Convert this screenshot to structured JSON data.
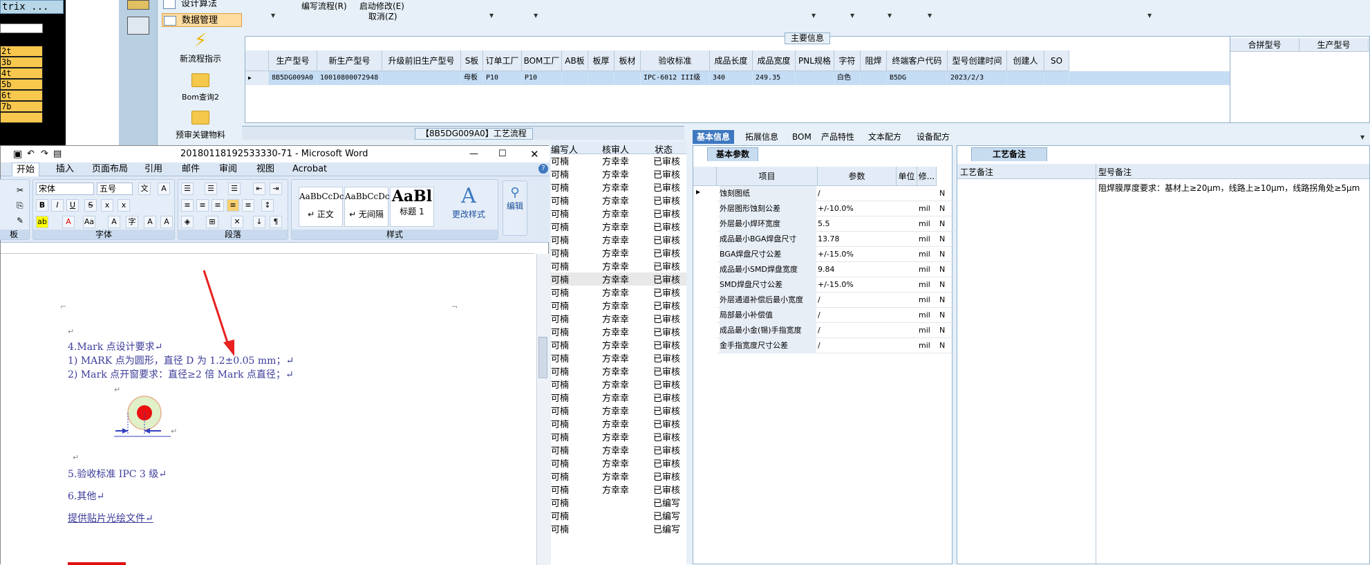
{
  "left_strip": {
    "title": "trix ...",
    "items": [
      "2t",
      "3b",
      "4t",
      "5b",
      "6t",
      "7b",
      ""
    ]
  },
  "nav": {
    "items": [
      {
        "label": "设计算法",
        "selected": false
      },
      {
        "label": "数据管理",
        "selected": true
      }
    ],
    "tools": [
      "新流程指示",
      "Bom查询2",
      "预审关键物料"
    ]
  },
  "menu": {
    "items": [
      "编写流程(R)",
      "启动修改(E)",
      "取消(Z)"
    ]
  },
  "main_info": {
    "title": "主要信息",
    "columns": [
      "生产型号",
      "新生产型号",
      "升级前旧生产型号",
      "S板",
      "订单工厂",
      "BOM工厂",
      "AB板",
      "板厚",
      "板材",
      "验收标准",
      "成品长度",
      "成品宽度",
      "PNL规格",
      "字符",
      "阻焊",
      "终端客户代码",
      "型号创建时间",
      "创建人",
      "SO"
    ],
    "row": [
      "8B5DG009A0",
      "10010800072948",
      "",
      "母板",
      "P10",
      "P10",
      "",
      "",
      "",
      "IPC-6012 III级",
      "340",
      "249.35",
      "",
      "白色",
      "",
      "B5DG",
      "2023/2/3",
      "",
      ""
    ],
    "side_columns": [
      "合拼型号",
      "生产型号"
    ]
  },
  "process": {
    "title": "【8B5DG009A0】工艺流程",
    "columns": [
      "编写人",
      "核审人",
      "状态"
    ],
    "writer": "可楠",
    "reviewers": [
      "方幸幸",
      "方幸幸",
      "方幸幸",
      "方幸幸",
      "方幸幸",
      "方幸幸",
      "方幸幸",
      "方幸幸",
      "方幸幸",
      "方幸幸",
      "方幸幸",
      "方幸幸",
      "方幸幸",
      "方幸幸",
      "方幸幸",
      "方幸幸",
      "方幸幸",
      "方幸幸",
      "方幸幸",
      "方幸幸",
      "方幸幸",
      "方幸幸",
      "方幸幸",
      "方幸幸",
      "方幸幸",
      "方幸幸",
      "",
      "",
      ""
    ],
    "statuses": [
      "已审核",
      "已审核",
      "已审核",
      "已审核",
      "已审核",
      "已审核",
      "已审核",
      "已审核",
      "已审核",
      "已审核",
      "已审核",
      "已审核",
      "已审核",
      "已审核",
      "已审核",
      "已审核",
      "已审核",
      "已审核",
      "已审核",
      "已审核",
      "已审核",
      "已审核",
      "已审核",
      "已审核",
      "已审核",
      "已审核",
      "已编写",
      "已编写",
      "已编写"
    ]
  },
  "tabs": [
    "基本信息",
    "拓展信息",
    "BOM",
    "产品特性",
    "文本配方",
    "设备配方"
  ],
  "basic": {
    "subtab": "基本参数",
    "columns": [
      "项目",
      "参数",
      "单位",
      "修..."
    ],
    "rows": [
      [
        "蚀刻图纸",
        "/",
        "",
        "N"
      ],
      [
        "外层图形蚀刻公差",
        "+/-10.0%",
        "mil",
        "N"
      ],
      [
        "外层最小焊环宽度",
        "5.5",
        "mil",
        "N"
      ],
      [
        "成品最小BGA焊盘尺寸",
        "13.78",
        "mil",
        "N"
      ],
      [
        "BGA焊盘尺寸公差",
        "+/-15.0%",
        "mil",
        "N"
      ],
      [
        "成品最小SMD焊盘宽度",
        "9.84",
        "mil",
        "N"
      ],
      [
        "SMD焊盘尺寸公差",
        "+/-15.0%",
        "mil",
        "N"
      ],
      [
        "外层通道补偿后最小宽度",
        "/",
        "mil",
        "N"
      ],
      [
        "局部最小补偿值",
        "/",
        "mil",
        "N"
      ],
      [
        "成品最小金(锡)手指宽度",
        "/",
        "mil",
        "N"
      ],
      [
        "金手指宽度尺寸公差",
        "/",
        "mil",
        "N"
      ]
    ]
  },
  "notes": {
    "subtab": "工艺备注",
    "columns": [
      "工艺备注",
      "型号备注"
    ],
    "model_note": "阻焊膜厚度要求：基材上≥20μm，线路上≥10μm，线路拐角处≥5μm"
  },
  "word": {
    "title": "20180118192533330-71 - Microsoft Word",
    "tabs": [
      "开始",
      "插入",
      "页面布局",
      "引用",
      "邮件",
      "审阅",
      "视图",
      "Acrobat"
    ],
    "font": "宋体",
    "size": "五号",
    "group_labels": [
      "板",
      "字体",
      "段落",
      "样式"
    ],
    "styles": [
      {
        "preview": "AaBbCcDc",
        "name": "↵ 正文"
      },
      {
        "preview": "AaBbCcDc",
        "name": "↵ 无间隔"
      },
      {
        "preview": "AaBl",
        "name": "标题 1"
      }
    ],
    "change_styles": "更改样式",
    "edit": "编辑",
    "doc_lines": [
      "4.Mark 点设计要求↵",
      "1) MARK 点为圆形，直径 D 为 1.2±0.05 mm；↵",
      "2) Mark 点开窗要求：直径≥2 倍 Mark 点直径；↵",
      "5.验收标准 IPC 3 级↵",
      "6.其他↵",
      "提供贴片光绘文件↵"
    ]
  }
}
